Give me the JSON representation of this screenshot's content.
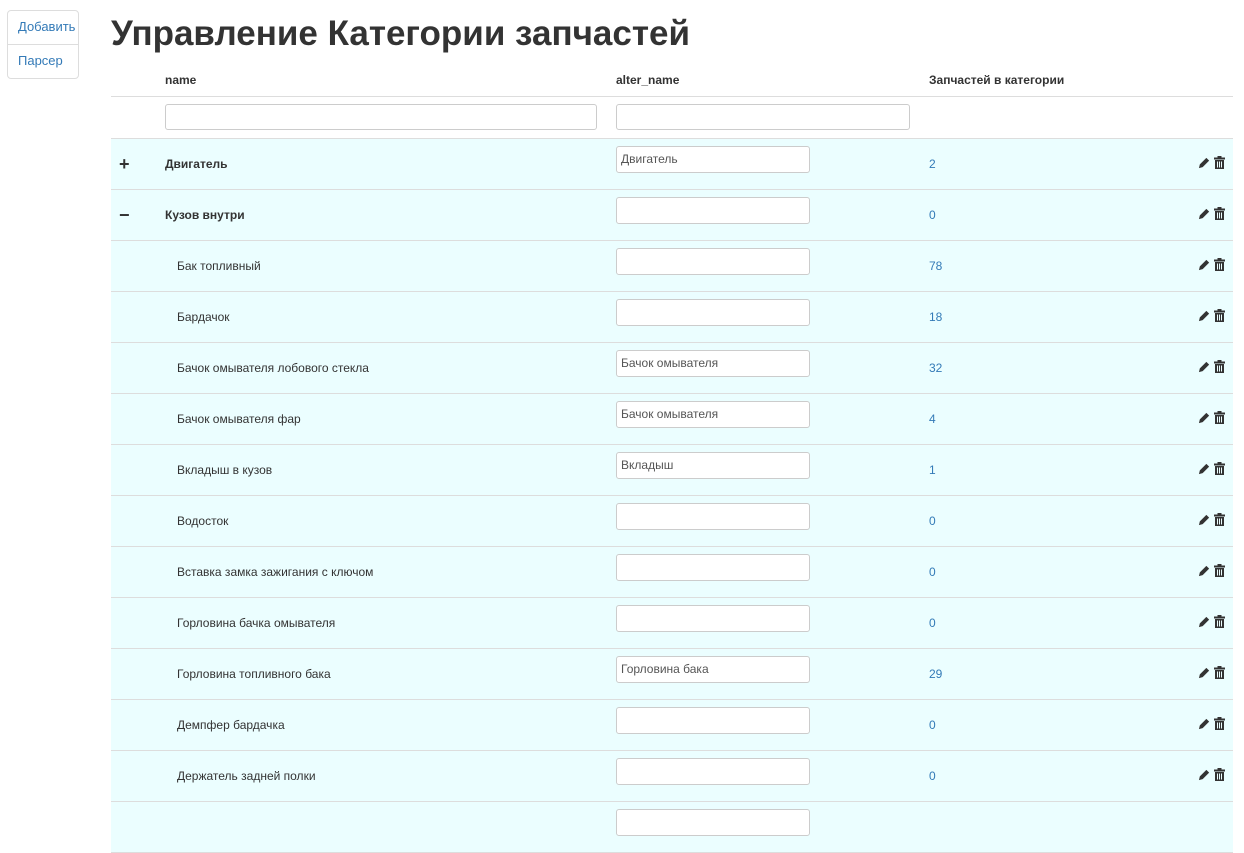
{
  "sidebar": {
    "items": [
      {
        "label": "Добавить"
      },
      {
        "label": "Парсер"
      }
    ]
  },
  "page_title": "Управление Категории запчастей",
  "columns": {
    "name": "name",
    "alter_name": "alter_name",
    "count": "Запчастей в категории"
  },
  "rows": [
    {
      "toggle": "+",
      "name": "Двигатель",
      "level": 0,
      "alter_name": "Двигатель",
      "count": "2"
    },
    {
      "toggle": "−",
      "name": "Кузов внутри",
      "level": 0,
      "alter_name": "",
      "count": "0"
    },
    {
      "name": "Бак топливный",
      "level": 1,
      "alter_name": "",
      "count": "78"
    },
    {
      "name": "Бардачок",
      "level": 1,
      "alter_name": "",
      "count": "18"
    },
    {
      "name": "Бачок омывателя лобового стекла",
      "level": 1,
      "alter_name": "Бачок омывателя",
      "count": "32"
    },
    {
      "name": "Бачок омывателя фар",
      "level": 1,
      "alter_name": "Бачок омывателя",
      "count": "4"
    },
    {
      "name": "Вкладыш в кузов",
      "level": 1,
      "alter_name": "Вкладыш",
      "count": "1"
    },
    {
      "name": "Водосток",
      "level": 1,
      "alter_name": "",
      "count": "0"
    },
    {
      "name": "Вставка замка зажигания с ключом",
      "level": 1,
      "alter_name": "",
      "count": "0"
    },
    {
      "name": "Горловина бачка омывателя",
      "level": 1,
      "alter_name": "",
      "count": "0"
    },
    {
      "name": "Горловина топливного бака",
      "level": 1,
      "alter_name": "Горловина бака",
      "count": "29"
    },
    {
      "name": "Демпфер бардачка",
      "level": 1,
      "alter_name": "",
      "count": "0"
    },
    {
      "name": "Держатель задней полки",
      "level": 1,
      "alter_name": "",
      "count": "0"
    },
    {
      "name": "",
      "level": 1,
      "alter_name": "",
      "count": ""
    }
  ]
}
